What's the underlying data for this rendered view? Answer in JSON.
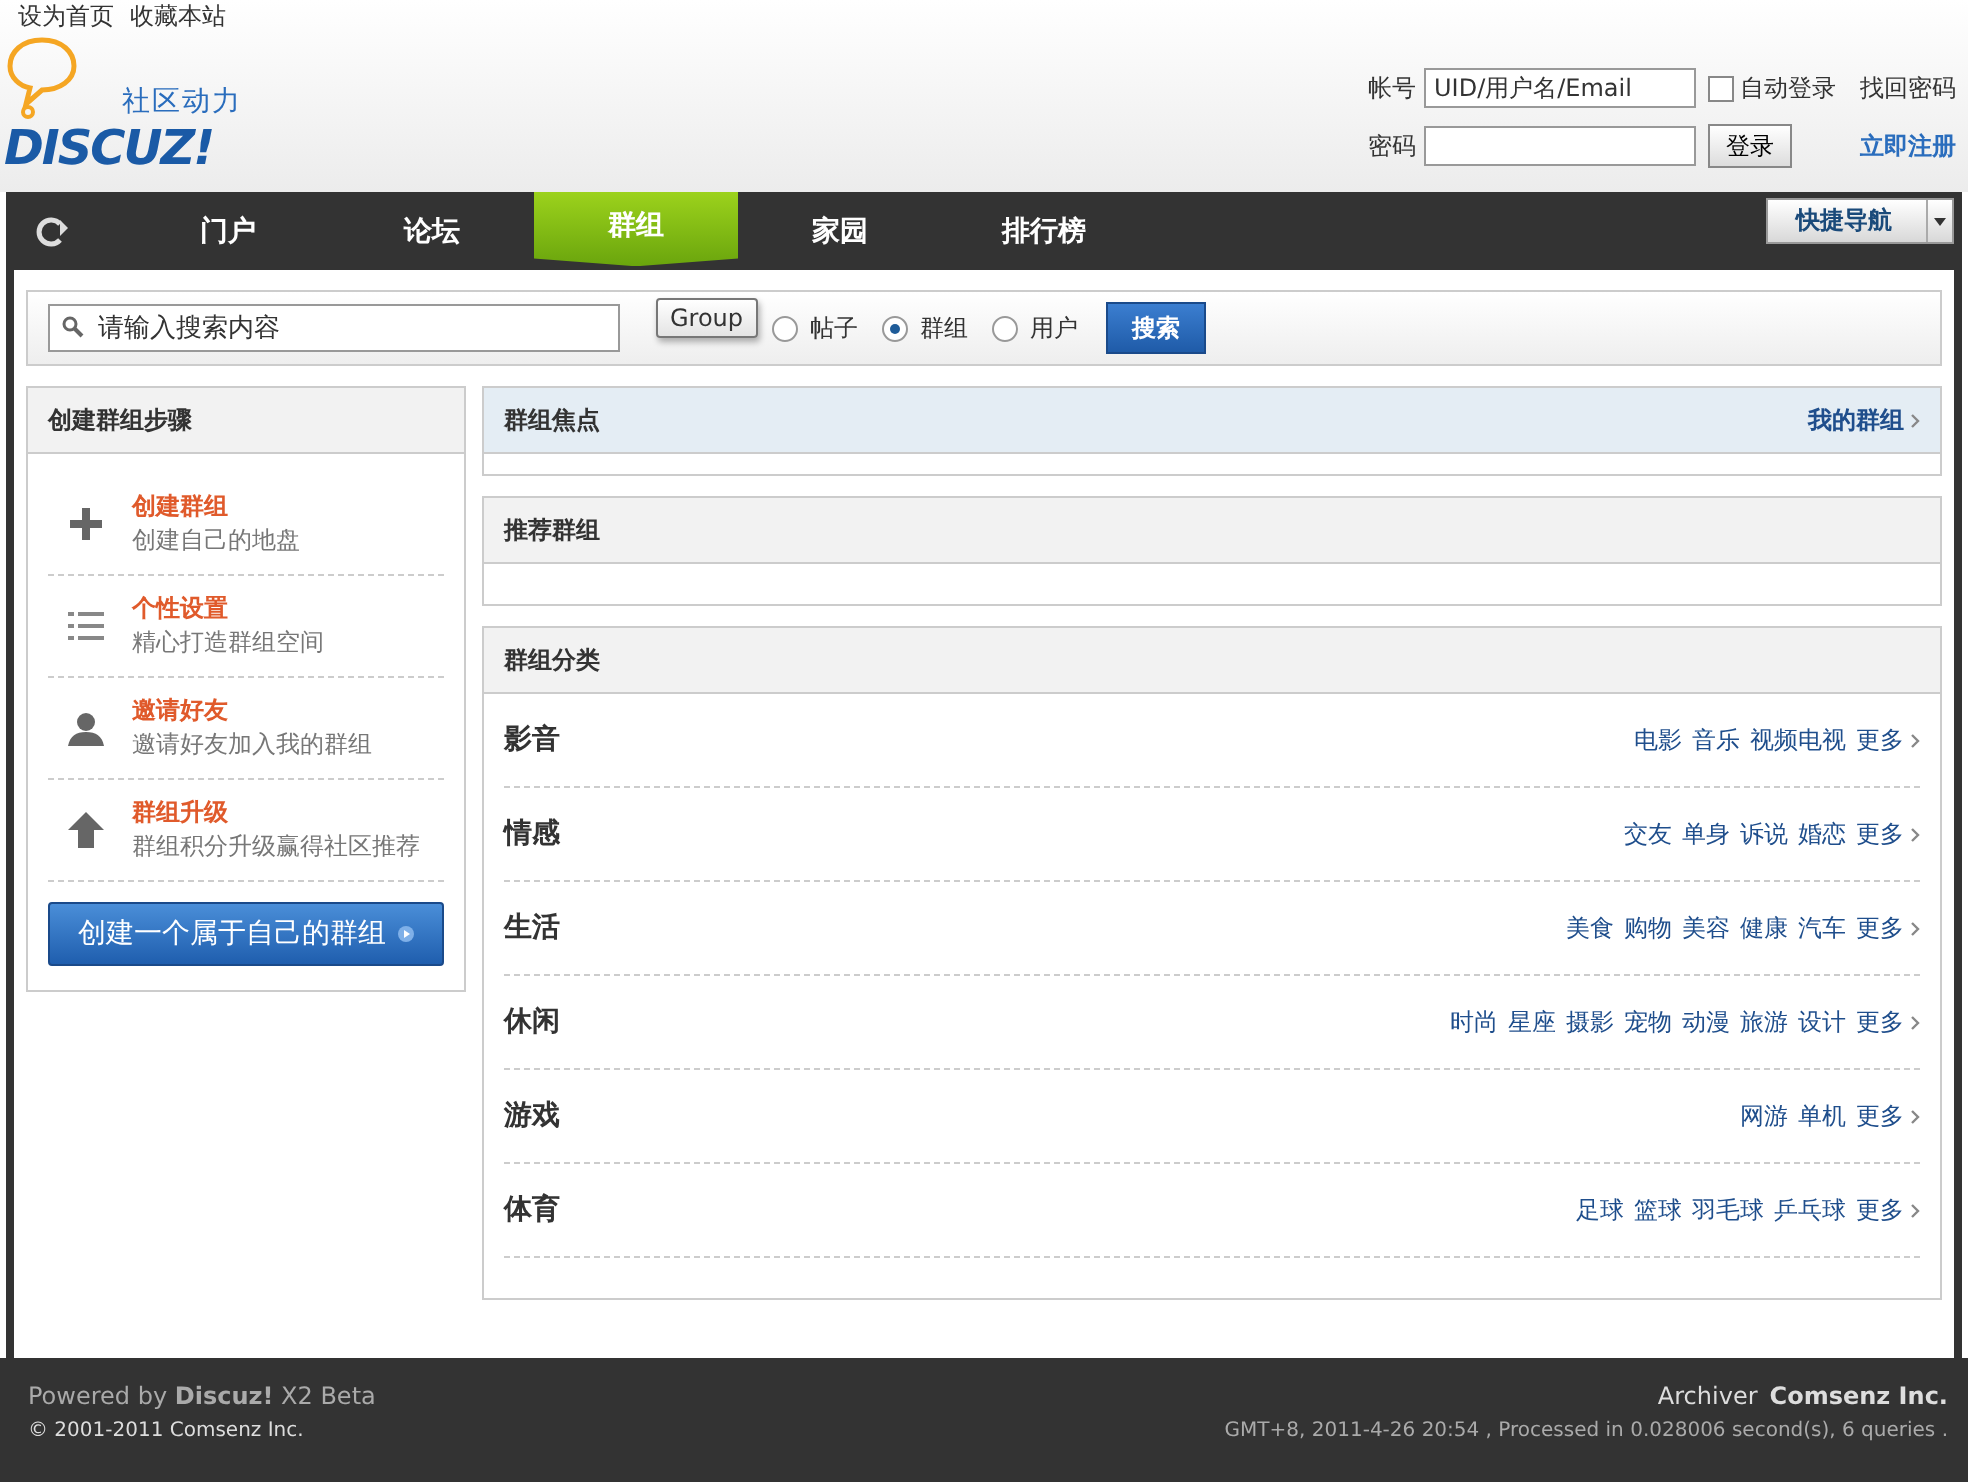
{
  "top_links": [
    "设为首页",
    "收藏本站"
  ],
  "logo": {
    "tagline": "社区动力",
    "wordmark": "DISCUZ!"
  },
  "login": {
    "account_label": "帐号",
    "account_value": "UID/用户名/Email",
    "auto_login": {
      "label": "自动登录",
      "checked": false
    },
    "forgot": "找回密码",
    "password_label": "密码",
    "login_button": "登录",
    "register": "立即注册"
  },
  "nav": {
    "items": [
      {
        "label": "门户",
        "selected": false
      },
      {
        "label": "论坛",
        "selected": false
      },
      {
        "label": "群组",
        "selected": true
      },
      {
        "label": "家园",
        "selected": false
      },
      {
        "label": "排行榜",
        "selected": false
      }
    ],
    "quick_nav": "快捷导航"
  },
  "search": {
    "placeholder": "请输入搜索内容",
    "tooltip": "Group",
    "options": [
      {
        "label": "帖子",
        "selected": false
      },
      {
        "label": "群组",
        "selected": true
      },
      {
        "label": "用户",
        "selected": false
      }
    ],
    "button": "搜索"
  },
  "steps": {
    "title": "创建群组步骤",
    "items": [
      {
        "kind": "plus",
        "title": "创建群组",
        "desc": "创建自己的地盘"
      },
      {
        "kind": "list",
        "title": "个性设置",
        "desc": "精心打造群组空间"
      },
      {
        "kind": "user",
        "title": "邀请好友",
        "desc": "邀请好友加入我的群组"
      },
      {
        "kind": "up",
        "title": "群组升级",
        "desc": "群组积分升级赢得社区推荐"
      }
    ],
    "create_button": "创建一个属于自己的群组"
  },
  "focus": {
    "title": "群组焦点",
    "link": "我的群组"
  },
  "recommend": {
    "title": "推荐群组"
  },
  "categories": {
    "title": "群组分类",
    "rows": [
      {
        "name": "影音",
        "tags": [
          "电影",
          "音乐",
          "视频电视"
        ],
        "more": "更多"
      },
      {
        "name": "情感",
        "tags": [
          "交友",
          "单身",
          "诉说",
          "婚恋"
        ],
        "more": "更多"
      },
      {
        "name": "生活",
        "tags": [
          "美食",
          "购物",
          "美容",
          "健康",
          "汽车"
        ],
        "more": "更多"
      },
      {
        "name": "休闲",
        "tags": [
          "时尚",
          "星座",
          "摄影",
          "宠物",
          "动漫",
          "旅游",
          "设计"
        ],
        "more": "更多"
      },
      {
        "name": "游戏",
        "tags": [
          "网游",
          "单机"
        ],
        "more": "更多"
      },
      {
        "name": "体育",
        "tags": [
          "足球",
          "篮球",
          "羽毛球",
          "乒乓球"
        ],
        "more": "更多"
      }
    ]
  },
  "footer": {
    "powered": "Powered by **Discuz!** X2 Beta",
    "copyright": "© 2001-2011 Comsenz Inc.",
    "archiver": "Archiver",
    "company": "Comsenz Inc.",
    "stats": "GMT+8, 2011-4-26 20:54 , Processed in 0.028006 second(s), 6 queries ."
  }
}
